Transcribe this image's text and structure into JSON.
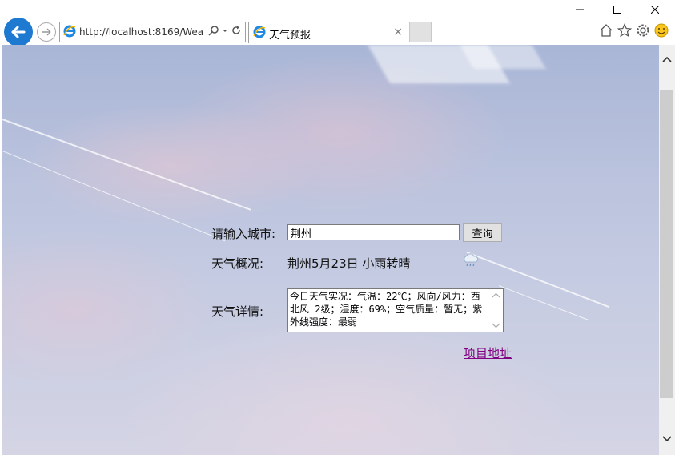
{
  "browser": {
    "url": "http://localhost:8169/Weat",
    "tab_title": "天气预报",
    "tab_close": "×"
  },
  "form": {
    "city_label": "请输入城市:",
    "city_value": "荆州",
    "query_button": "查询",
    "summary_label": "天气概况:",
    "summary_value": "荆州5月23日 小雨转晴",
    "detail_label": "天气详情:",
    "detail_value": "今日天气实况：气温：22℃；风向/风力：西北风 2级；湿度：69%；空气质量：暂无；紫外线强度：最弱",
    "project_link": "项目地址"
  },
  "icons": {
    "weather": "cloud-rain-icon",
    "back": "back-arrow-icon",
    "forward": "forward-arrow-icon"
  },
  "colors": {
    "link_visited": "#800080",
    "back_button": "#1e7ad0"
  }
}
